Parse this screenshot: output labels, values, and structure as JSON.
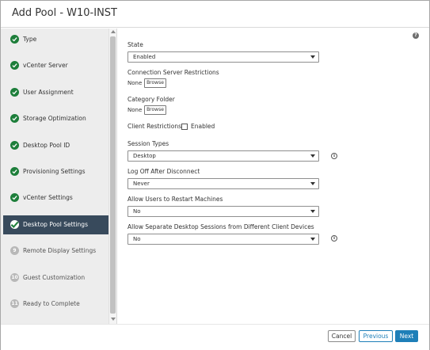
{
  "dialog": {
    "title": "Add Pool - W10-INST"
  },
  "colors": {
    "accent": "#1e7fb8",
    "complete": "#1d7e3a",
    "active_step_bg": "#384a5c",
    "pending": "#b8b8b8"
  },
  "steps": [
    {
      "label": "Type",
      "status": "complete",
      "icon": "check-icon"
    },
    {
      "label": "vCenter Server",
      "status": "complete",
      "icon": "check-icon"
    },
    {
      "label": "User Assignment",
      "status": "complete",
      "icon": "check-icon"
    },
    {
      "label": "Storage Optimization",
      "status": "complete",
      "icon": "check-icon"
    },
    {
      "label": "Desktop Pool ID",
      "status": "complete",
      "icon": "check-icon"
    },
    {
      "label": "Provisioning Settings",
      "status": "complete",
      "icon": "check-icon"
    },
    {
      "label": "vCenter Settings",
      "status": "complete",
      "icon": "check-icon"
    },
    {
      "label": "Desktop Pool Settings",
      "status": "active",
      "icon": "check-icon"
    },
    {
      "label": "Remote Display Settings",
      "status": "pending",
      "number": "9"
    },
    {
      "label": "Guest Customization",
      "status": "pending",
      "number": "10"
    },
    {
      "label": "Ready to Complete",
      "status": "pending",
      "number": "11"
    }
  ],
  "form": {
    "state": {
      "label": "State",
      "value": "Enabled"
    },
    "connection_server": {
      "label": "Connection Server Restrictions",
      "none": "None",
      "browse": "Browse"
    },
    "category_folder": {
      "label": "Category Folder",
      "none": "None",
      "browse": "Browse"
    },
    "client_restrictions": {
      "label": "Client Restrictions",
      "checkbox_label": "Enabled",
      "checked": false
    },
    "session_types": {
      "label": "Session Types",
      "value": "Desktop"
    },
    "log_off": {
      "label": "Log Off After Disconnect",
      "value": "Never"
    },
    "restart_machines": {
      "label": "Allow Users to Restart Machines",
      "value": "No"
    },
    "separate_sessions": {
      "label": "Allow Separate Desktop Sessions from Different Client Devices",
      "value": "No"
    }
  },
  "footer": {
    "cancel": "Cancel",
    "previous": "Previous",
    "next": "Next"
  }
}
